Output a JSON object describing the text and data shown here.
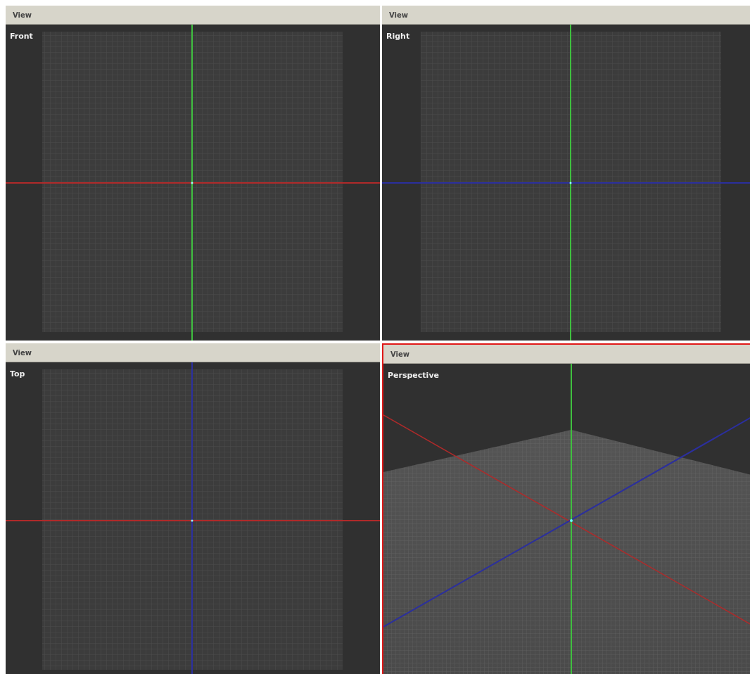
{
  "viewports": [
    {
      "menu": "View",
      "label": "Front",
      "kind": "front",
      "selected": false
    },
    {
      "menu": "View",
      "label": "Right",
      "kind": "right",
      "selected": false
    },
    {
      "menu": "View",
      "label": "Top",
      "kind": "top",
      "selected": false
    },
    {
      "menu": "View",
      "label": "Perspective",
      "kind": "perspective",
      "selected": true
    }
  ]
}
